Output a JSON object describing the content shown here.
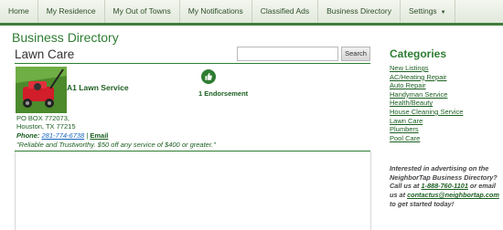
{
  "nav": {
    "items": [
      "Home",
      "My Residence",
      "My Out of Towns",
      "My Notifications",
      "Classified Ads",
      "Business Directory",
      "Settings"
    ]
  },
  "page": {
    "title": "Business Directory",
    "category": "Lawn Care"
  },
  "search": {
    "value": "",
    "placeholder": "",
    "button_label": "Search"
  },
  "listing": {
    "name": "A1 Lawn Service",
    "endorsements": "1 Endorsement",
    "address_line1": "PO BOX 772073,",
    "address_line2": "Houston, TX 77215",
    "phone_label": "Phone:",
    "phone": "281-774-6738",
    "separator": "|",
    "email_label": "Email",
    "tagline": "\"Reliable and Trustworthy. $50 off any service of $400 or greater.\""
  },
  "sidebar": {
    "title": "Categories",
    "categories": [
      "New Listings",
      "AC/Heating Repair",
      "Auto Repair",
      "Handyman Service",
      "Health/Beauty",
      "House Cleaning Service",
      "Lawn Care",
      "Plumbers",
      "Pool Care"
    ],
    "promo": {
      "text1": "Interested in advertising on the NeighborTap Business Directory? Call us at",
      "phone": "1-888-760-1101",
      "text2": "or email us at",
      "email": "contactus@neighbortap.com",
      "text3": "to get started today!"
    }
  },
  "colors": {
    "brand_green": "#2e7d32",
    "link_blue": "#1565c0",
    "nav_border": "#3f7d3a"
  },
  "icons": {
    "endorse": "thumbs-up-icon",
    "settings_caret": "caret-down-icon"
  }
}
